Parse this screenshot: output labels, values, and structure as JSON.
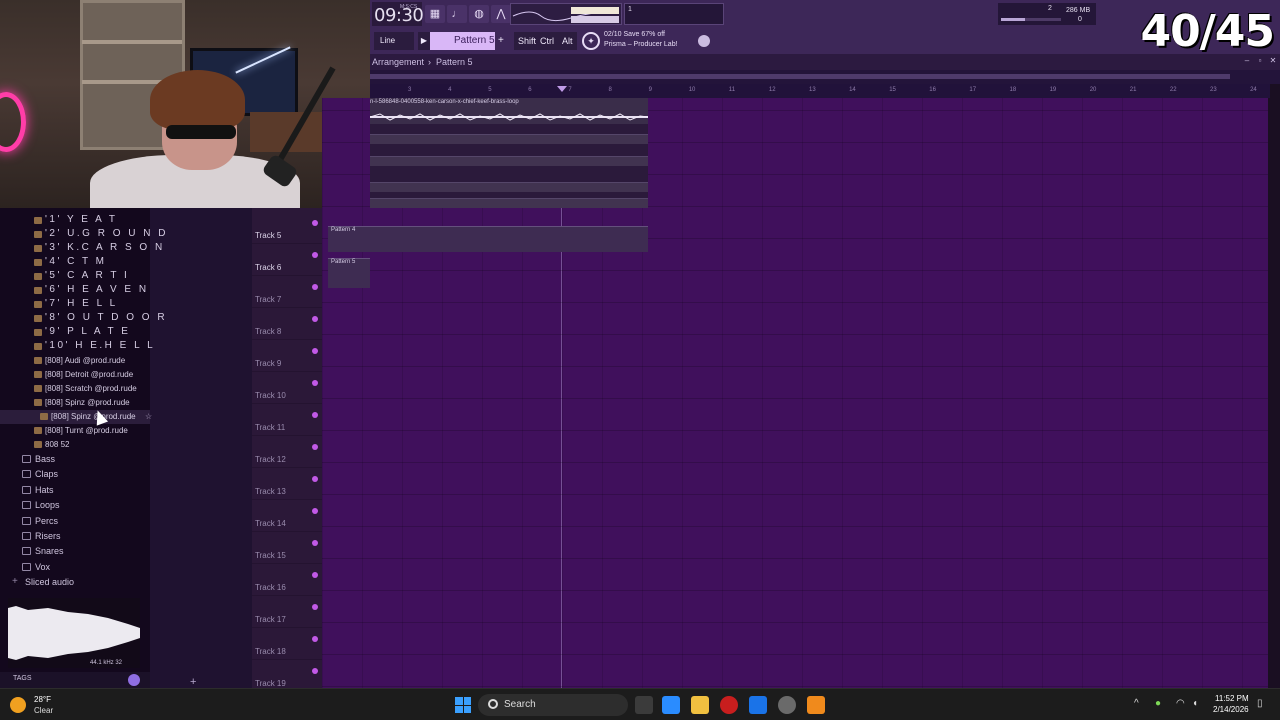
{
  "toolbar": {
    "time": "09:30",
    "time_unit": "M:S:CS",
    "snap": "Line",
    "pattern": "Pattern 5",
    "pattern_add": "+",
    "shift_label": "Shift",
    "ctrl_label": "Ctrl",
    "alt_label": "Alt",
    "promo_count": "02/10",
    "promo_line1": "Save 67% off",
    "promo_line2": "Prisma – Producer Lab!",
    "mem_left": "1",
    "mem_cpu": "2",
    "mem_mb": "286 MB",
    "mem_zero": "0"
  },
  "counter": "40/45",
  "arrangement": {
    "crumb1": "Arrangement",
    "crumb_sep": "›",
    "crumb2": "Pattern 5",
    "audio_clip_label": "n-l-586848-0400558-ken-carson-x-chief-keef-brass-loop",
    "ruler": [
      "3",
      "4",
      "5",
      "6",
      "7",
      "8",
      "9",
      "10",
      "11",
      "12",
      "13",
      "14",
      "15",
      "16",
      "17",
      "18",
      "19",
      "20",
      "21",
      "22",
      "23",
      "24"
    ],
    "clip_pattern4": "Pattern 4",
    "clip_pattern5": "Pattern 5",
    "tracks": [
      "Track 5",
      "Track 6",
      "Track 7",
      "Track 8",
      "Track 9",
      "Track 10",
      "Track 11",
      "Track 12",
      "Track 13",
      "Track 14",
      "Track 15",
      "Track 16",
      "Track 17",
      "Track 18",
      "Track 19"
    ]
  },
  "browser": {
    "items": [
      "'1' Y E A T",
      "'2' U.G R O U N D",
      "'3' K.C A R S O N",
      "'4' C T M",
      "'5' C A R T I",
      "'6' H E A V E N",
      "'7' H E L L",
      "'8' O U T D O O R",
      "'9' P L A T E",
      "'10' H E.H E L L",
      "[808] Audi @prod.rude",
      "[808] Detroit @prod.rude",
      "[808] Scratch @prod.rude",
      "[808] Spinz @prod.rude",
      "[808] Spinz @prod.rude",
      "[808] Turnt @prod.rude",
      "808 52"
    ],
    "folders": [
      "Bass",
      "Claps",
      "Hats",
      "Loops",
      "Percs",
      "Risers",
      "Snares",
      "Vox",
      "Sliced audio"
    ],
    "wave_info": "44.1 kHz 32",
    "tags": "TAGS"
  },
  "taskbar": {
    "temp": "28°F",
    "condition": "Clear",
    "search": "Search",
    "time": "11:52 PM",
    "date": "2/14/2026"
  }
}
